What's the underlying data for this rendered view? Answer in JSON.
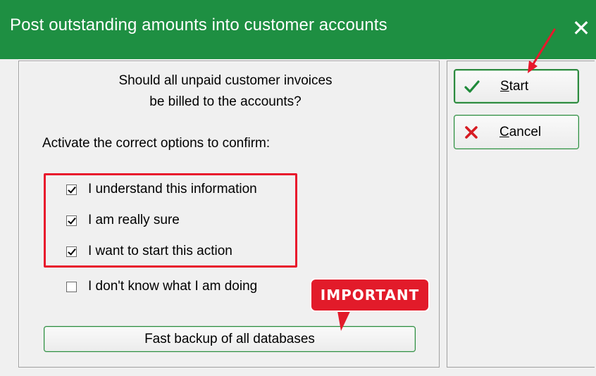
{
  "window": {
    "title": "Post outstanding amounts into customer accounts",
    "close_glyph": "✕"
  },
  "dialog": {
    "question_line1": "Should all unpaid customer invoices",
    "question_line2": "be billed to the accounts?",
    "instruction": "Activate the correct options to confirm:",
    "options": [
      {
        "label": "I understand this information",
        "checked": true
      },
      {
        "label": "I am really sure",
        "checked": true
      },
      {
        "label": "I want to start this action",
        "checked": true
      },
      {
        "label": "I don't know what I am doing",
        "checked": false
      }
    ],
    "backup_button": "Fast backup of all databases",
    "badge": "IMPORTANT"
  },
  "buttons": {
    "start": {
      "mnemonic": "S",
      "rest": "tart",
      "icon": "checkmark-icon"
    },
    "cancel": {
      "mnemonic": "C",
      "rest": "ancel",
      "icon": "x-icon"
    }
  },
  "colors": {
    "title_bar": "#1e8f42",
    "highlight": "#e8182c",
    "badge": "#e21b2a",
    "button_border": "#2d8a3f"
  }
}
